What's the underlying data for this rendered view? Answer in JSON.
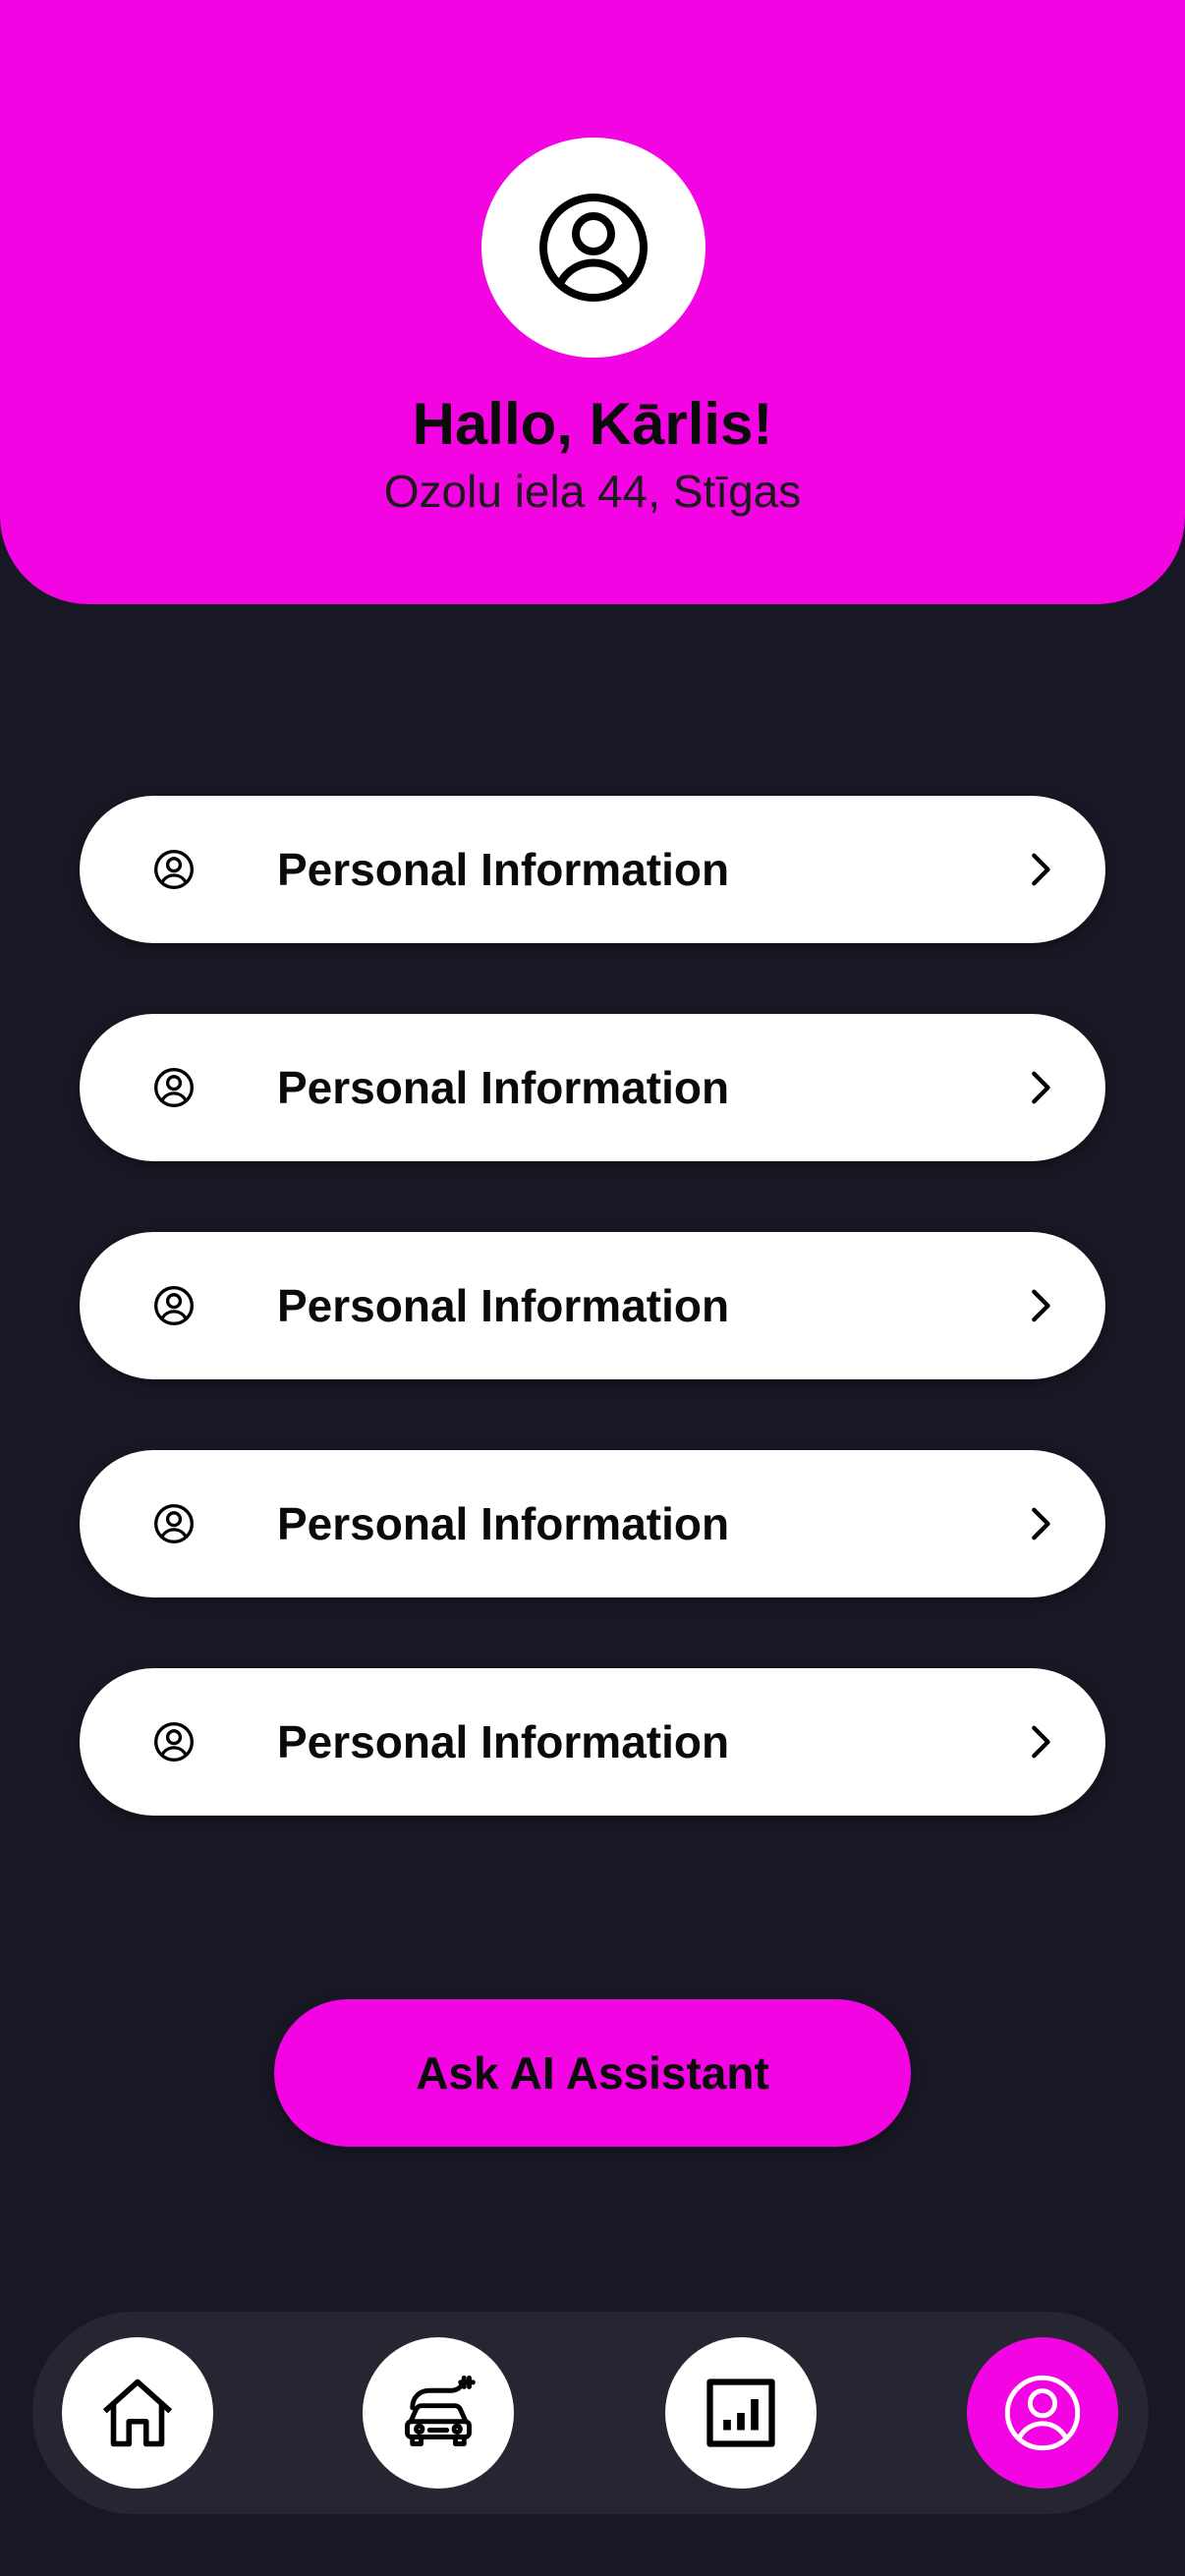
{
  "header": {
    "greeting": "Hallo, Kārlis!",
    "address": "Ozolu iela 44, Stīgas",
    "avatar_icon": "user-circle-icon",
    "background_color": "#F205E2"
  },
  "menu": {
    "items": [
      {
        "label": "Personal Information",
        "icon": "user-circle-icon",
        "trailing_icon": "chevron-right-icon"
      },
      {
        "label": "Personal Information",
        "icon": "user-circle-icon",
        "trailing_icon": "chevron-right-icon"
      },
      {
        "label": "Personal Information",
        "icon": "user-circle-icon",
        "trailing_icon": "chevron-right-icon"
      },
      {
        "label": "Personal Information",
        "icon": "user-circle-icon",
        "trailing_icon": "chevron-right-icon"
      },
      {
        "label": "Personal Information",
        "icon": "user-circle-icon",
        "trailing_icon": "chevron-right-icon"
      }
    ]
  },
  "ai_button": {
    "label": "Ask AI Assistant"
  },
  "bottom_nav": {
    "items": [
      {
        "name": "home",
        "icon": "home-icon",
        "active": false
      },
      {
        "name": "charging",
        "icon": "electric-car-icon",
        "active": false
      },
      {
        "name": "stats",
        "icon": "bar-chart-icon",
        "active": false
      },
      {
        "name": "profile",
        "icon": "user-circle-icon",
        "active": true
      }
    ],
    "active_color": "#F205E2"
  },
  "colors": {
    "background": "#181824",
    "accent": "#F205E2",
    "card": "#FFFFFF",
    "nav_bar": "#262633"
  }
}
